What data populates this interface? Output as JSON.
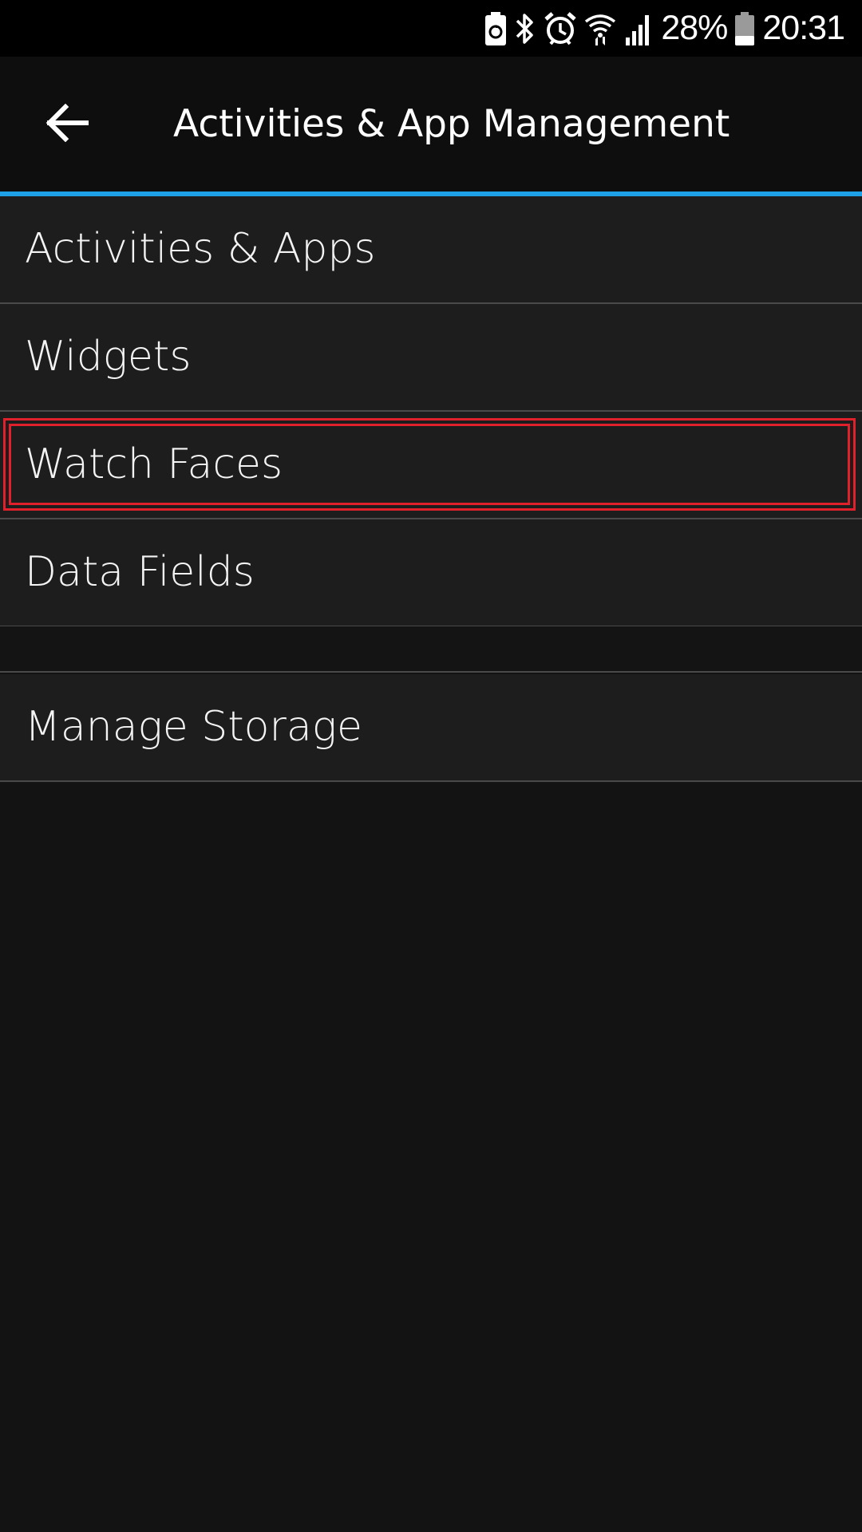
{
  "status_bar": {
    "battery_percent": "28%",
    "time": "20:31",
    "icons": [
      "battery-saver-icon",
      "bluetooth-icon",
      "alarm-icon",
      "wifi-icon",
      "signal-icon",
      "battery-icon"
    ]
  },
  "app_bar": {
    "title": "Activities & App Management",
    "back_icon": "arrow-left-icon"
  },
  "colors": {
    "accent": "#1ea1e6",
    "highlight": "#e0202a",
    "background": "#131313",
    "row_background": "#1d1d1d"
  },
  "menu": {
    "items": [
      {
        "label": "Activities & Apps"
      },
      {
        "label": "Widgets"
      },
      {
        "label": "Watch Faces",
        "highlighted": true
      },
      {
        "label": "Data Fields"
      },
      {
        "label": "Manage Storage"
      }
    ]
  }
}
